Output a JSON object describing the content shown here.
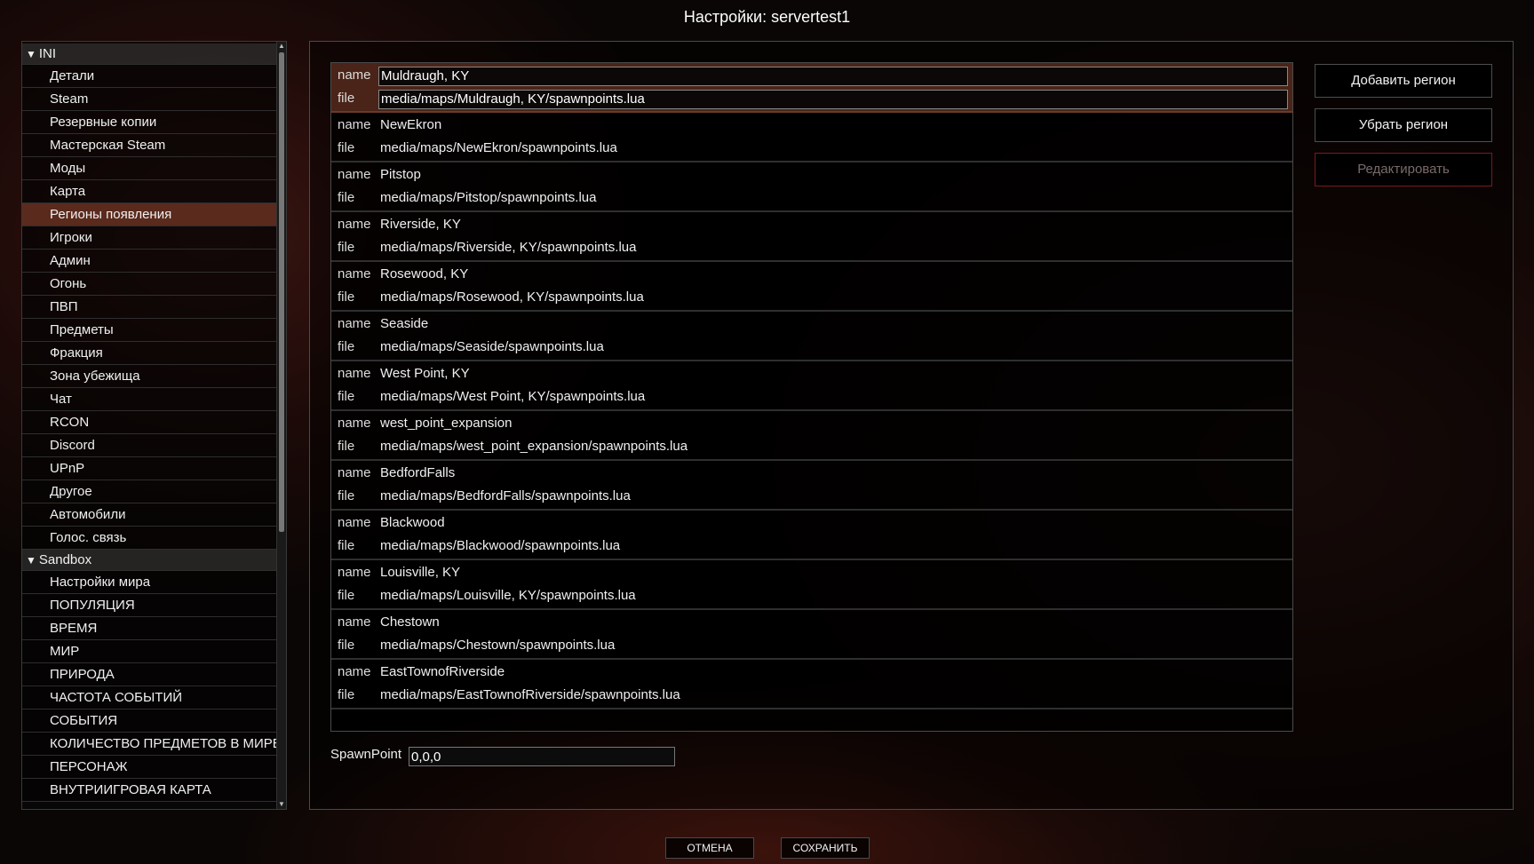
{
  "title": "Настройки: servertest1",
  "nav": {
    "ini_group": "INI",
    "ini_items": [
      "Детали",
      "Steam",
      "Резервные копии",
      "Мастерская Steam",
      "Моды",
      "Карта",
      "Регионы появления",
      "Игроки",
      "Админ",
      "Огонь",
      "ПВП",
      "Предметы",
      "Фракция",
      "Зона убежища",
      "Чат",
      "RCON",
      "Discord",
      "UPnP",
      "Другое",
      "Автомобили",
      "Голос. связь"
    ],
    "selected": "Регионы появления",
    "sandbox_group": "Sandbox",
    "sandbox_items": [
      "Настройки мира",
      "ПОПУЛЯЦИЯ",
      "ВРЕМЯ",
      "МИР",
      "ПРИРОДА",
      "ЧАСТОТА СОБЫТИЙ",
      "СОБЫТИЯ",
      "КОЛИЧЕСТВО ПРЕДМЕТОВ В МИРЕ",
      "ПЕРСОНАЖ",
      "ВНУТРИИГРОВАЯ КАРТА"
    ]
  },
  "regions_keys": {
    "name": "name",
    "file": "file"
  },
  "regions": [
    {
      "name": "Muldraugh, KY",
      "file": "media/maps/Muldraugh, KY/spawnpoints.lua"
    },
    {
      "name": "NewEkron",
      "file": "media/maps/NewEkron/spawnpoints.lua"
    },
    {
      "name": "Pitstop",
      "file": "media/maps/Pitstop/spawnpoints.lua"
    },
    {
      "name": "Riverside, KY",
      "file": "media/maps/Riverside, KY/spawnpoints.lua"
    },
    {
      "name": "Rosewood, KY",
      "file": "media/maps/Rosewood, KY/spawnpoints.lua"
    },
    {
      "name": "Seaside",
      "file": "media/maps/Seaside/spawnpoints.lua"
    },
    {
      "name": "West Point, KY",
      "file": "media/maps/West Point, KY/spawnpoints.lua"
    },
    {
      "name": "west_point_expansion",
      "file": "media/maps/west_point_expansion/spawnpoints.lua"
    },
    {
      "name": "BedfordFalls",
      "file": "media/maps/BedfordFalls/spawnpoints.lua"
    },
    {
      "name": "Blackwood",
      "file": "media/maps/Blackwood/spawnpoints.lua"
    },
    {
      "name": "Louisville, KY",
      "file": "media/maps/Louisville, KY/spawnpoints.lua"
    },
    {
      "name": "Chestown",
      "file": "media/maps/Chestown/spawnpoints.lua"
    },
    {
      "name": "EastTownofRiverside",
      "file": "media/maps/EastTownofRiverside/spawnpoints.lua"
    }
  ],
  "selected_region_index": 0,
  "actions": {
    "add": "Добавить регион",
    "remove": "Убрать регион",
    "edit": "Редактировать"
  },
  "spawn": {
    "label": "SpawnPoint",
    "value": "0,0,0"
  },
  "footer": {
    "cancel": "ОТМЕНА",
    "save": "СОХРАНИТЬ"
  },
  "colors": {
    "selected_bg": "#5a2a1d",
    "disabled_border": "#7a1a1a"
  }
}
